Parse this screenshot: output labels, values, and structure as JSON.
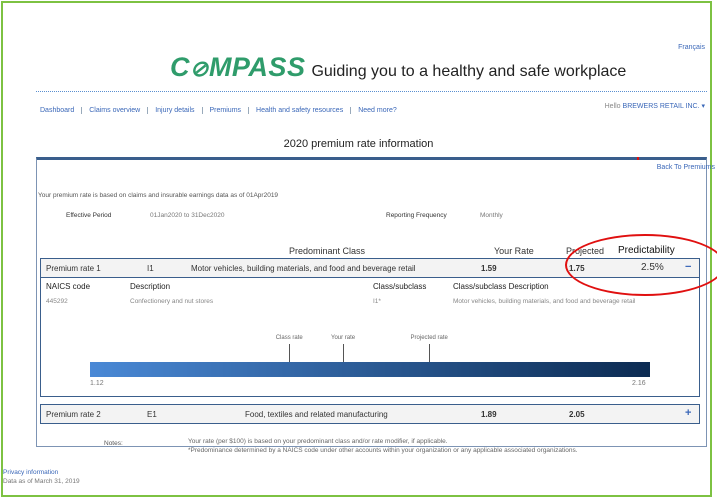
{
  "header": {
    "language_link": "Français",
    "logo_text": "COMPASS",
    "tagline": "Guiding you to a healthy and safe workplace"
  },
  "nav": {
    "items": [
      "Dashboard",
      "Claims overview",
      "Injury details",
      "Premiums",
      "Health and safety resources",
      "Need more?"
    ],
    "greeting": "Hello",
    "account_name": "BREWERS RETAIL INC. ▾"
  },
  "page": {
    "title": "2020 premium rate information",
    "back_link": "Back To Premiums",
    "basis_note": "Your premium rate is based on claims and insurable earnings data as of 01Apr2019",
    "effective_period_label": "Effective Period",
    "effective_period_value": "01Jan2020 to 31Dec2020",
    "reporting_frequency_label": "Reporting Frequency",
    "reporting_frequency_value": "Monthly"
  },
  "table_headers": {
    "predominant_class": "Predominant Class",
    "your_rate": "Your Rate",
    "projected": "Projected",
    "predictability": "Predictability"
  },
  "rates": [
    {
      "label": "Premium rate 1",
      "code": "I1",
      "description": "Motor vehicles, building materials, and food and beverage retail",
      "your_rate": "1.59",
      "projected": "1.75",
      "predictability": "2.5%",
      "toggle": "−"
    },
    {
      "label": "Premium rate 2",
      "code": "E1",
      "description": "Food, textiles and related manufacturing",
      "your_rate": "1.89",
      "projected": "2.05",
      "toggle": "+"
    }
  ],
  "naics": {
    "headers": {
      "code": "NAICS code",
      "description": "Description",
      "class": "Class/subclass",
      "class_description": "Class/subclass Description"
    },
    "row": {
      "code": "445292",
      "description": "Confectionery and nut stores",
      "class": "I1*",
      "class_description": "Motor vehicles, building materials, and food and beverage retail"
    }
  },
  "rate_scale": {
    "min_label": "1.12",
    "max_label": "2.16",
    "min": 1.12,
    "max": 2.16,
    "markers": [
      {
        "label": "Class rate",
        "value": 1.49
      },
      {
        "label": "Your rate",
        "value": 1.59
      },
      {
        "label": "Projected rate",
        "value": 1.75
      }
    ]
  },
  "notes": {
    "label": "Notes:",
    "line1": "Your rate (per $100) is based on your predominant class and/or rate modifier, if applicable.",
    "line2": "*Predominance determined by a NAICS code under other accounts within your organization or any applicable associated organizations."
  },
  "footer": {
    "privacy": "Privacy information",
    "data_as_of": "Data as of March 31, 2019"
  },
  "colors": {
    "accent_green": "#7dc242",
    "link_blue": "#3a67b8",
    "annotation_red": "#e01010",
    "scale_start": "#4a89d6",
    "scale_end": "#0c2b52"
  }
}
